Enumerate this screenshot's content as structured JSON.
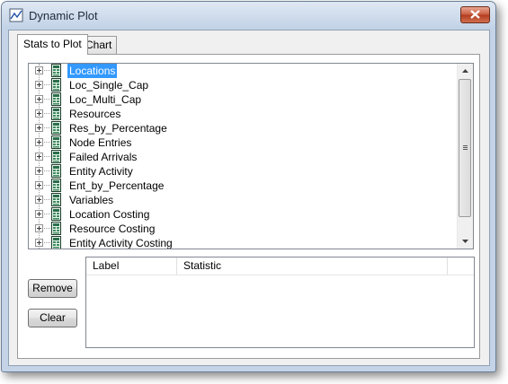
{
  "window": {
    "title": "Dynamic Plot",
    "app_icon": "chart-icon"
  },
  "tabs": [
    {
      "label": "Stats to Plot",
      "active": true
    },
    {
      "label": "Chart",
      "active": false
    }
  ],
  "tree": {
    "selected_index": 0,
    "items": [
      {
        "label": "Locations"
      },
      {
        "label": "Loc_Single_Cap"
      },
      {
        "label": "Loc_Multi_Cap"
      },
      {
        "label": "Resources"
      },
      {
        "label": "Res_by_Percentage"
      },
      {
        "label": "Node Entries"
      },
      {
        "label": "Failed Arrivals"
      },
      {
        "label": "Entity Activity"
      },
      {
        "label": "Ent_by_Percentage"
      },
      {
        "label": "Variables"
      },
      {
        "label": "Location Costing"
      },
      {
        "label": "Resource Costing"
      },
      {
        "label": "Entity Activity Costing"
      }
    ]
  },
  "buttons": {
    "remove": "Remove",
    "clear": "Clear"
  },
  "list": {
    "columns": [
      "Label",
      "Statistic"
    ]
  },
  "colors": {
    "selection": "#3399ff",
    "close_button": "#c75034"
  }
}
